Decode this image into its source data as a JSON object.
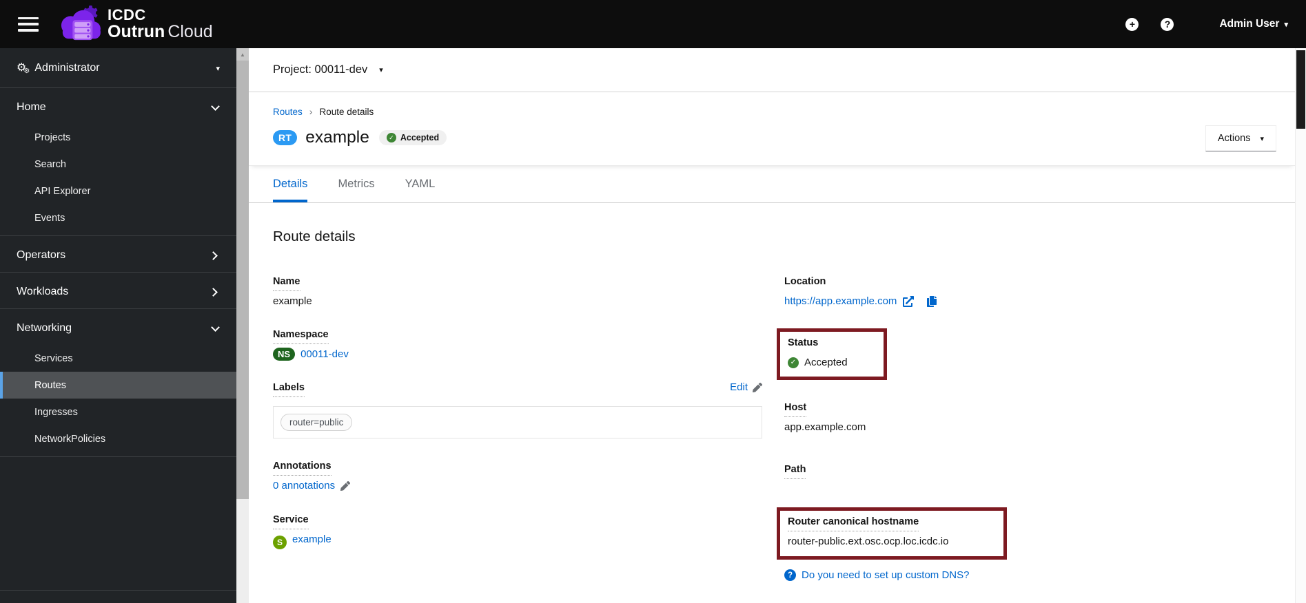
{
  "header": {
    "brand_top": "ICDC",
    "brand_bottom_strong": "Outrun",
    "brand_bottom_light": "Cloud",
    "user_label": "Admin User"
  },
  "icons": {
    "caret_down": "▾",
    "breadcrumb_sep": "›",
    "scroll_up": "▲",
    "check": "✓",
    "question": "?",
    "plus": "+",
    "gear": "⚙"
  },
  "sidebar": {
    "perspective_label": "Administrator",
    "sections": [
      {
        "label": "Home",
        "state": "expanded",
        "items": [
          "Projects",
          "Search",
          "API Explorer",
          "Events"
        ]
      },
      {
        "label": "Operators",
        "state": "collapsed"
      },
      {
        "label": "Workloads",
        "state": "collapsed"
      },
      {
        "label": "Networking",
        "state": "expanded",
        "items": [
          "Services",
          "Routes",
          "Ingresses",
          "NetworkPolicies"
        ]
      }
    ],
    "selected_item": "Routes"
  },
  "project_bar": {
    "label": "Project: 00011-dev"
  },
  "page_header": {
    "breadcrumb": {
      "parent": "Routes",
      "current": "Route details"
    },
    "resource_badge": "RT",
    "title": "example",
    "status_badge": "Accepted",
    "actions_label": "Actions"
  },
  "tabs": {
    "active": "Details",
    "items": [
      {
        "label": "Details"
      },
      {
        "label": "Metrics"
      },
      {
        "label": "YAML"
      }
    ]
  },
  "content": {
    "heading": "Route details",
    "left": {
      "name": {
        "label": "Name",
        "value": "example"
      },
      "namespace": {
        "label": "Namespace",
        "badge": "NS",
        "value": "00011-dev"
      },
      "labels": {
        "label": "Labels",
        "edit": "Edit",
        "chips": [
          "router=public"
        ]
      },
      "annotations": {
        "label": "Annotations",
        "value": "0 annotations"
      },
      "service": {
        "label": "Service",
        "badge": "S",
        "value": "example"
      }
    },
    "right": {
      "location": {
        "label": "Location",
        "value": "https://app.example.com"
      },
      "status": {
        "label": "Status",
        "value": "Accepted"
      },
      "host": {
        "label": "Host",
        "value": "app.example.com"
      },
      "path": {
        "label": "Path",
        "value": ""
      },
      "router": {
        "label": "Router canonical hostname",
        "value": "router-public.ext.osc.ocp.loc.icdc.io"
      },
      "dns_help": "Do you need to set up custom DNS?"
    }
  },
  "colors": {
    "header_bg": "#0d0d0d",
    "sidebar_bg": "#212427",
    "sidebar_selected_bg": "#4f5255",
    "sidebar_selected_border": "#5ba3e7",
    "link_blue": "#0066cc",
    "resource_badge_blue": "#2b9af3",
    "namespace_badge_green": "#1e641e",
    "service_badge_green": "#6ca100",
    "success_green": "#3e8635",
    "annotation_red": "#7d1a21"
  }
}
